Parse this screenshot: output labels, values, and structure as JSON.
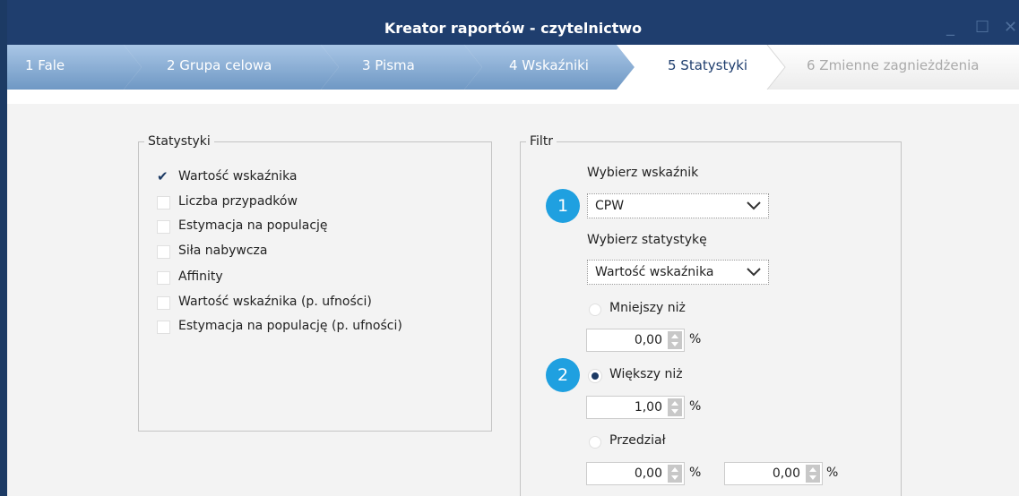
{
  "window": {
    "title": "Kreator raportów - czytelnictwo",
    "minimize_icon": "_",
    "maximize_icon": "☐",
    "close_icon": "✕"
  },
  "wizard": {
    "steps": [
      {
        "label": "1  Fale",
        "state": "done"
      },
      {
        "label": "2 Grupa celowa",
        "state": "done"
      },
      {
        "label": "3 Pisma",
        "state": "done"
      },
      {
        "label": "4 Wskaźniki",
        "state": "done"
      },
      {
        "label": "5 Statystyki",
        "state": "active"
      },
      {
        "label": "6 Zmienne zagnieżdżenia",
        "state": "disabled"
      }
    ]
  },
  "statystyki": {
    "legend": "Statystyki",
    "items": [
      {
        "label": "Wartość wskaźnika",
        "checked": true
      },
      {
        "label": "Liczba przypadków",
        "checked": false
      },
      {
        "label": "Estymacja na populację",
        "checked": false
      },
      {
        "label": "Siła nabywcza",
        "checked": false
      },
      {
        "label": "Affinity",
        "checked": false
      },
      {
        "label": "Wartość wskaźnika (p. ufności)",
        "checked": false
      },
      {
        "label": "Estymacja na populację (p. ufności)",
        "checked": false
      }
    ]
  },
  "filtr": {
    "legend": "Filtr",
    "indicator_label": "Wybierz wskaźnik",
    "indicator_value": "CPW",
    "statistic_label": "Wybierz statystykę",
    "statistic_value": "Wartość wskaźnika",
    "less_label": "Mniejszy niż",
    "less_value": "0,00",
    "greater_label": "Większy niż",
    "greater_value": "1,00",
    "range_label": "Przedział",
    "range_from": "0,00",
    "range_to": "0,00",
    "percent": "%",
    "selected_option": "Większy niż"
  },
  "callouts": [
    "1",
    "2"
  ],
  "colors": {
    "titlebar": "#1f3e6e",
    "wizard_done": "#7fa8d0",
    "wizard_active": "#ffffff",
    "badge": "#1fa0e0"
  }
}
